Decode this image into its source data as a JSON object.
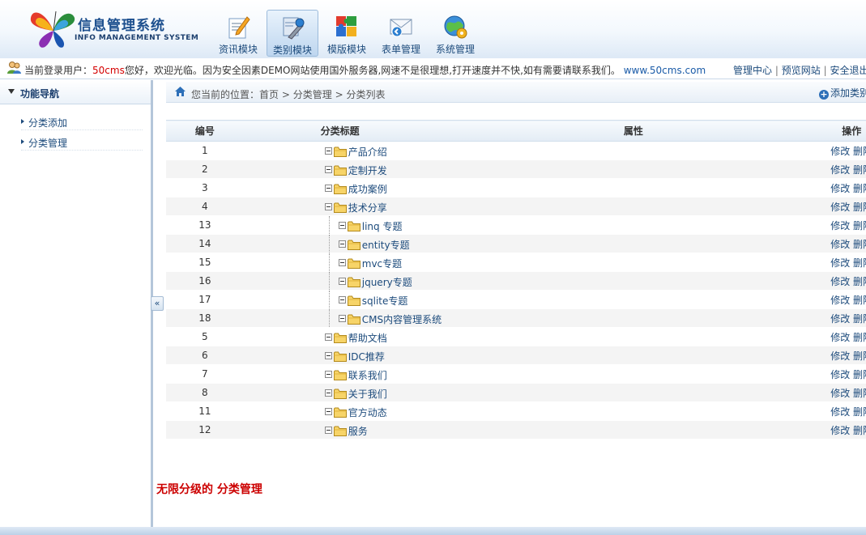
{
  "header": {
    "title": "信息管理系统",
    "subtitle": "INFO MANAGEMENT SYSTEM",
    "modules": [
      {
        "label": "资讯模块",
        "icon": "pencil-doc-icon"
      },
      {
        "label": "类别模块",
        "icon": "tools-icon"
      },
      {
        "label": "模版模块",
        "icon": "puzzle-icon"
      },
      {
        "label": "表单管理",
        "icon": "envelope-icon"
      },
      {
        "label": "系统管理",
        "icon": "globe-gear-icon"
      }
    ]
  },
  "infobar": {
    "prefix": "当前登录用户：",
    "user": "50cms",
    "message": "您好，欢迎光临。因为安全因素DEMO网站使用国外服务器,网速不是很理想,打开速度并不快,如有需要请联系我们。",
    "url": "www.50cms.com",
    "links": [
      "管理中心",
      "预览网站",
      "安全退出"
    ],
    "separator": "|"
  },
  "sidebar": {
    "title": "功能导航",
    "items": [
      "分类添加",
      "分类管理"
    ]
  },
  "breadcrumb": {
    "prefix": "您当前的位置：",
    "path": [
      "首页",
      "分类管理",
      "分类列表"
    ],
    "separator": ">",
    "add_label": "添加类别"
  },
  "table": {
    "headers": {
      "id": "编号",
      "title": "分类标题",
      "attr": "属性",
      "ops": "操作"
    },
    "edit_label": "修改",
    "delete_label": "删除",
    "rows": [
      {
        "id": "1",
        "title": "产品介绍",
        "level": 0
      },
      {
        "id": "2",
        "title": "定制开发",
        "level": 0
      },
      {
        "id": "3",
        "title": "成功案例",
        "level": 0
      },
      {
        "id": "4",
        "title": "技术分享",
        "level": 0
      },
      {
        "id": "13",
        "title": "linq 专题",
        "level": 1
      },
      {
        "id": "14",
        "title": "entity专题",
        "level": 1
      },
      {
        "id": "15",
        "title": "mvc专题",
        "level": 1
      },
      {
        "id": "16",
        "title": "jquery专题",
        "level": 1
      },
      {
        "id": "17",
        "title": "sqlite专题",
        "level": 1
      },
      {
        "id": "18",
        "title": "CMS内容管理系统",
        "level": 1
      },
      {
        "id": "5",
        "title": "帮助文档",
        "level": 0
      },
      {
        "id": "6",
        "title": "IDC推荐",
        "level": 0
      },
      {
        "id": "7",
        "title": "联系我们",
        "level": 0
      },
      {
        "id": "8",
        "title": "关于我们",
        "level": 0
      },
      {
        "id": "11",
        "title": "官方动态",
        "level": 0
      },
      {
        "id": "12",
        "title": "服务",
        "level": 0
      }
    ]
  },
  "note": "无限分级的 分类管理",
  "colors": {
    "accent": "#1d4b7c",
    "note": "#cc0000",
    "user": "#d40000"
  }
}
